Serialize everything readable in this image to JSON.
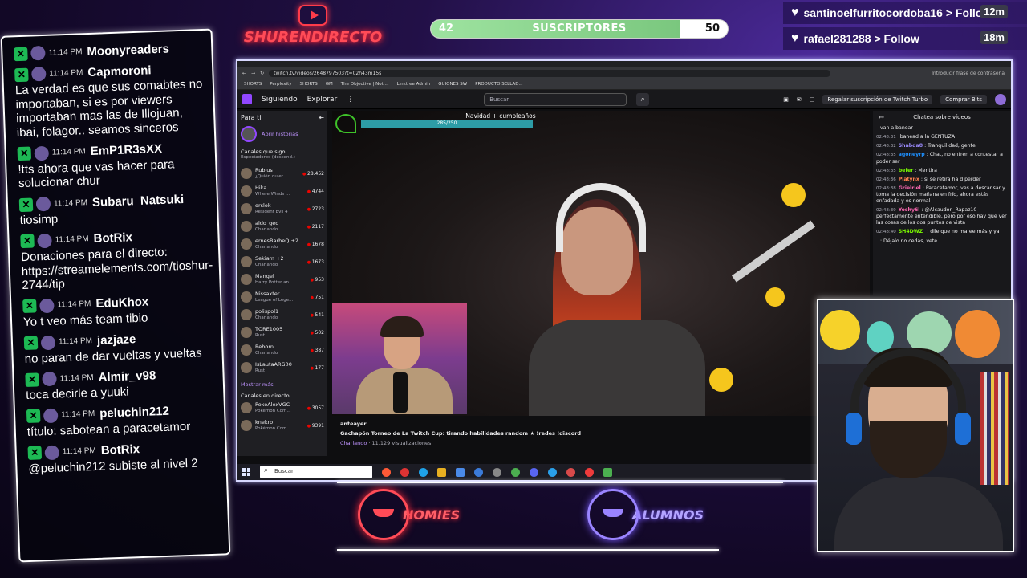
{
  "overlay": {
    "logo_text": "SHURENDIRECTO",
    "subs": {
      "current": "42",
      "goal": "50",
      "label": "SUSCRIPTORES",
      "progress": 0.84
    },
    "follows": [
      {
        "name": "santinoelfurritocordoba16 > Follow",
        "time": "12m"
      },
      {
        "name": "rafael281288 > Follow",
        "time": "18m"
      }
    ],
    "teams": {
      "left": "HOMIES",
      "right": "ALUMNOS"
    }
  },
  "stream_chat": [
    {
      "time": "11:14 PM",
      "user": "Moonyreaders",
      "text": ""
    },
    {
      "time": "11:14 PM",
      "user": "Capmoroni",
      "text": "La verdad es que sus comabtes no importaban, si es por viewers importaban mas las de Illojuan, ibai, folagor.. seamos sinceros"
    },
    {
      "time": "11:14 PM",
      "user": "EmP1R3sXX",
      "text": "!tts ahora que vas hacer para solucionar chur"
    },
    {
      "time": "11:14 PM",
      "user": "Subaru_Natsuki",
      "text": "tiosimp"
    },
    {
      "time": "11:14 PM",
      "user": "BotRix",
      "text": "Donaciones para el directo: https://streamelements.com/tioshur-2744/tip"
    },
    {
      "time": "11:14 PM",
      "user": "EduKhox",
      "text": "Yo t veo más team tibio"
    },
    {
      "time": "11:14 PM",
      "user": "jazjaze",
      "text": "no paran de dar vueltas y vueltas"
    },
    {
      "time": "11:14 PM",
      "user": "Almir_v98",
      "text": "toca decirle a yuuki"
    },
    {
      "time": "11:14 PM",
      "user": "peluchin212",
      "text": "título: sabotean a paracetamor"
    },
    {
      "time": "11:14 PM",
      "user": "BotRix",
      "text": "@peluchin212 subiste al nivel 2"
    }
  ],
  "browser": {
    "url": "twitch.tv/videos/2648797503?t=02h43m15s",
    "password_prompt": "Introducir frase de contraseña",
    "bookmarks": [
      "SHORTS",
      "Perplexity",
      "SHORTS",
      "GM",
      "The Objective | Noti...",
      "Linktree Admin",
      "GUIONES SW",
      "PRODUCTO SELLAD..."
    ],
    "twitch_header": {
      "following": "Siguiendo",
      "browse": "Explorar",
      "search_placeholder": "Buscar",
      "turbo": "Regalar suscripción de Twitch Turbo",
      "bits": "Comprar Bits"
    },
    "sidebar": {
      "title": "Para ti",
      "stories": "Abrir historias",
      "followed": "Canales que sigo",
      "sort": "Espectadores (descend.)",
      "channels": [
        {
          "name": "Rubius",
          "game": "¿Quién quier...",
          "viewers": "28.452"
        },
        {
          "name": "Hika",
          "game": "Where Winds ...",
          "viewers": "4744"
        },
        {
          "name": "orslok",
          "game": "Resident Evil 4",
          "viewers": "2723"
        },
        {
          "name": "aldo_geo",
          "game": "Charlando",
          "viewers": "2117"
        },
        {
          "name": "ernesBarbeQ +2",
          "game": "Charlando",
          "viewers": "1678"
        },
        {
          "name": "Sekiam +2",
          "game": "Charlando",
          "viewers": "1673"
        },
        {
          "name": "Mangel",
          "game": "Harry Potter an...",
          "viewers": "953"
        },
        {
          "name": "Nissaxter",
          "game": "League of Lege...",
          "viewers": "751"
        },
        {
          "name": "polispol1",
          "game": "Charlando",
          "viewers": "541"
        },
        {
          "name": "TORE1005",
          "game": "Rust",
          "viewers": "502"
        },
        {
          "name": "Reborn",
          "game": "Charlando",
          "viewers": "387"
        },
        {
          "name": "IsLautaARG00",
          "game": "Rust",
          "viewers": "177"
        }
      ],
      "show_more": "Mostrar más",
      "live_title": "Canales en directo",
      "live": [
        {
          "name": "PokeAlexVGC",
          "game": "Pokémon Com...",
          "viewers": "3057"
        },
        {
          "name": "knekro",
          "game": "Pokémon Com...",
          "viewers": "9391"
        }
      ]
    },
    "player": {
      "goal_title": "Navidad + cumpleaños",
      "goal_progress": "285/250"
    },
    "video": {
      "channel": "anteayer",
      "title": "Gachapón Torneo de La Twitch Cup: tirando habilidades random ★ !redes !discord",
      "category": "Charlando",
      "views": "· 11.129 visualizaciones"
    },
    "twitch_chat": {
      "title": "Chatea sobre vídeos",
      "messages": [
        {
          "time": "",
          "user": "",
          "text": "van a banear"
        },
        {
          "time": "02:48:31",
          "user": "",
          "text": "banead a la GENTUZA"
        },
        {
          "time": "02:48:32",
          "user": "Shabda8",
          "text": ": Tranquilidad, gente"
        },
        {
          "time": "02:48:35",
          "user": "agoneyrp",
          "text": ": Chat, no entren a contestar a poder ser"
        },
        {
          "time": "02:48:35",
          "user": "befer",
          "text": ": Mentira"
        },
        {
          "time": "02:48:36",
          "user": "Platynx",
          "text": ": si se retira ha d perder"
        },
        {
          "time": "02:48:38",
          "user": "Grielriel",
          "text": ": Paracetamor, ves a descansar y toma la decisión mañana en frío, ahora estás enfadada y es normal"
        },
        {
          "time": "02:48:39",
          "user": "Yoshy6l",
          "text": ": @Alcaudon_Rapaz10 perfectamente entendible, pero por eso hay que ver las cosas de los dos puntos de vista"
        },
        {
          "time": "02:48:40",
          "user": "SH4DWZ_",
          "text": ": dile que no maree más y ya"
        },
        {
          "time": "",
          "user": "",
          "text": ": Déjalo no cedas, vete"
        }
      ]
    },
    "taskbar_search": "Buscar"
  }
}
